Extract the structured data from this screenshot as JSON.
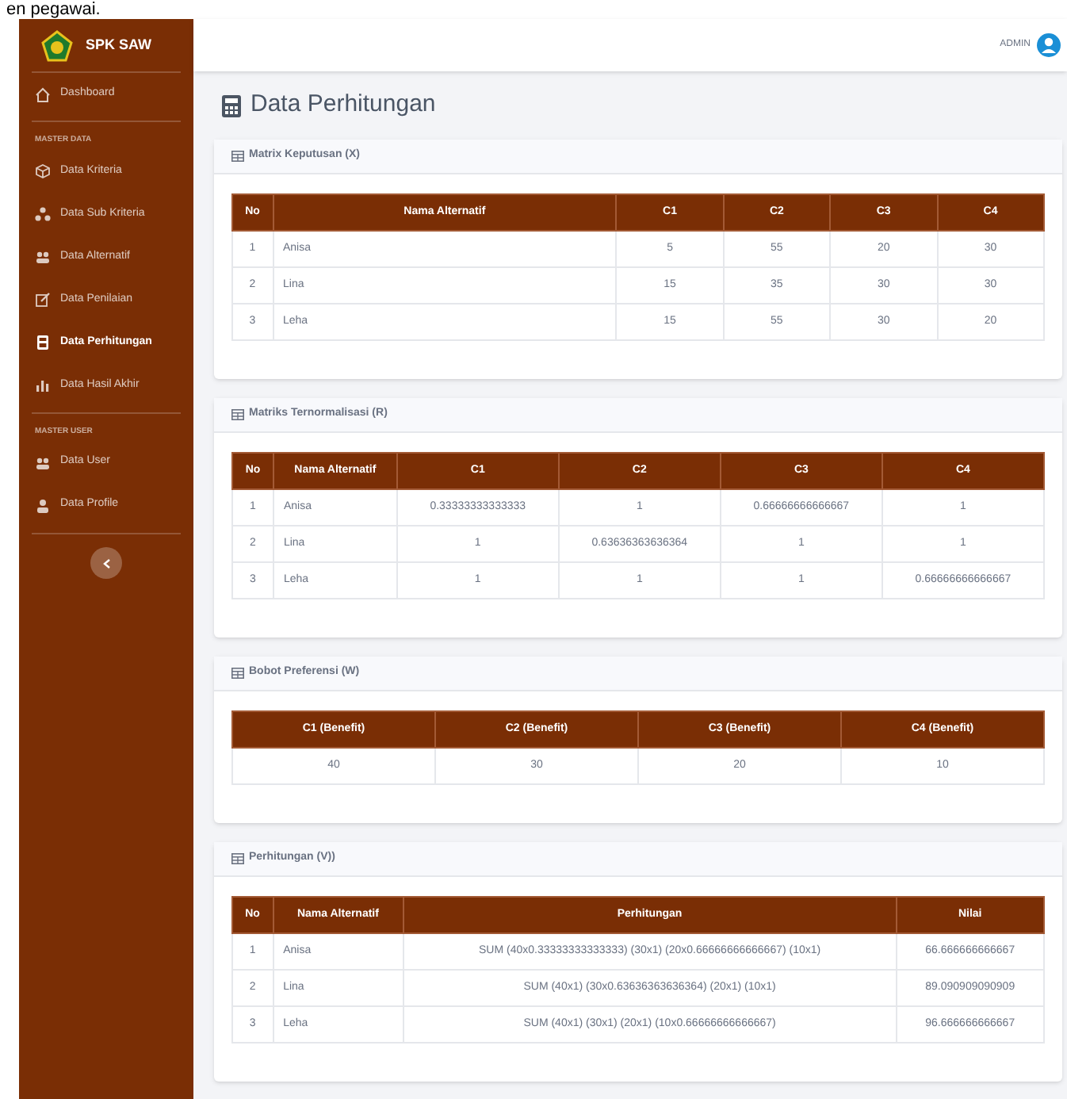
{
  "doc_caption": "en pegawai.",
  "sidebar": {
    "brand": "SPK SAW",
    "items": [
      {
        "kind": "link",
        "label": "Dashboard",
        "selected": false
      },
      {
        "kind": "heading",
        "label": "MASTER DATA"
      },
      {
        "kind": "link",
        "label": "Data Kriteria",
        "selected": false
      },
      {
        "kind": "link",
        "label": "Data Sub Kriteria",
        "selected": false
      },
      {
        "kind": "link",
        "label": "Data Alternatif",
        "selected": false
      },
      {
        "kind": "link",
        "label": "Data Penilaian",
        "selected": false
      },
      {
        "kind": "link",
        "label": "Data Perhitungan",
        "selected": true
      },
      {
        "kind": "link",
        "label": "Data Hasil Akhir",
        "selected": false
      },
      {
        "kind": "heading",
        "label": "MASTER USER"
      },
      {
        "kind": "link",
        "label": "Data User",
        "selected": false
      },
      {
        "kind": "link",
        "label": "Data Profile",
        "selected": false
      }
    ]
  },
  "topbar": {
    "user": "ADMIN"
  },
  "page_title": "Data Perhitungan",
  "cards": [
    {
      "title": "Matrix Keputusan (X)",
      "table": {
        "columns": [
          "No",
          "Nama Alternatif",
          "C1",
          "C2",
          "C3",
          "C4"
        ],
        "rows": [
          [
            "1",
            "Anisa",
            "5",
            "55",
            "20",
            "30"
          ],
          [
            "2",
            "Lina",
            "15",
            "35",
            "30",
            "30"
          ],
          [
            "3",
            "Leha",
            "15",
            "55",
            "30",
            "20"
          ]
        ]
      }
    },
    {
      "title": "Matriks Ternormalisasi (R)",
      "table": {
        "columns": [
          "No",
          "Nama Alternatif",
          "C1",
          "C2",
          "C3",
          "C4"
        ],
        "rows": [
          [
            "1",
            "Anisa",
            "0.33333333333333",
            "1",
            "0.66666666666667",
            "1"
          ],
          [
            "2",
            "Lina",
            "1",
            "0.63636363636364",
            "1",
            "1"
          ],
          [
            "3",
            "Leha",
            "1",
            "1",
            "1",
            "0.66666666666667"
          ]
        ]
      }
    },
    {
      "title": "Bobot Preferensi (W)",
      "table": {
        "columns": [
          "C1 (Benefit)",
          "C2 (Benefit)",
          "C3 (Benefit)",
          "C4 (Benefit)"
        ],
        "rows": [
          [
            "40",
            "30",
            "20",
            "10"
          ]
        ]
      }
    },
    {
      "title": "Perhitungan (V))",
      "table": {
        "columns": [
          "No",
          "Nama Alternatif",
          "Perhitungan",
          "Nilai"
        ],
        "rows": [
          [
            "1",
            "Anisa",
            "SUM (40x0.33333333333333) (30x1) (20x0.66666666666667) (10x1)",
            "66.666666666667"
          ],
          [
            "2",
            "Lina",
            "SUM (40x1) (30x0.63636363636364) (20x1) (10x1)",
            "89.090909090909"
          ],
          [
            "3",
            "Leha",
            "SUM (40x1) (30x1) (20x1) (10x0.66666666666667)",
            "96.666666666667"
          ]
        ]
      }
    }
  ]
}
